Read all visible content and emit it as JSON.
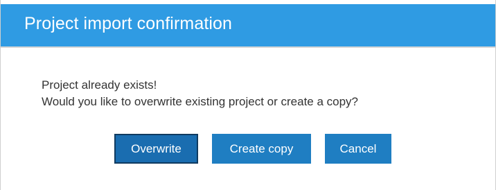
{
  "dialog": {
    "title": "Project import confirmation",
    "message": {
      "line1": "Project already exists!",
      "line2": "Would you like to overwrite existing project or create a copy?"
    },
    "buttons": {
      "overwrite": "Overwrite",
      "create_copy": "Create copy",
      "cancel": "Cancel"
    }
  },
  "colors": {
    "title_bar": "#2f9be3",
    "button": "#1f7ec2",
    "button_focused_border": "#103b60"
  }
}
